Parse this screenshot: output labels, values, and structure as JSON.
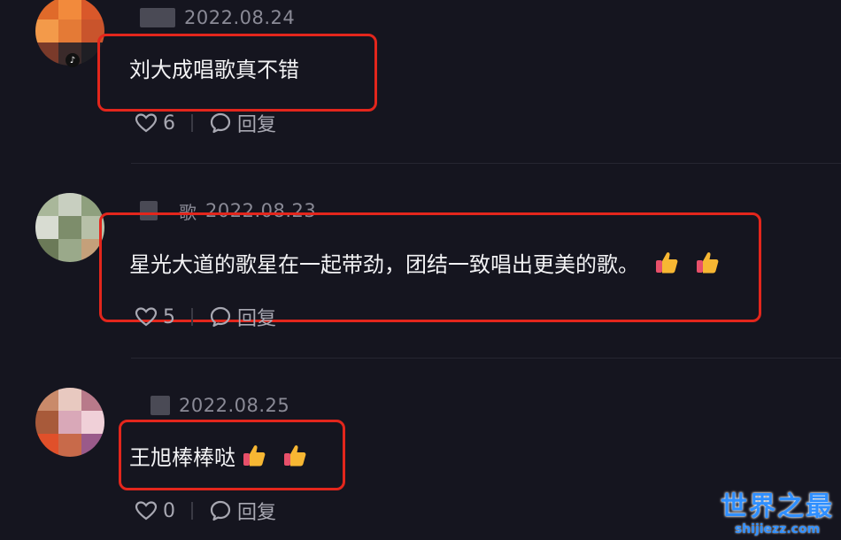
{
  "comments": [
    {
      "name": "",
      "date": "2022.08.24",
      "text": "刘大成唱歌真不错",
      "likes": "6",
      "reply_label": "回复",
      "emojis": []
    },
    {
      "name": "歌",
      "date": "2022.08.23",
      "text": "星光大道的歌星在一起带劲，团结一致唱出更美的歌。",
      "likes": "5",
      "reply_label": "回复",
      "emojis": [
        "thumbs-up",
        "thumbs-up"
      ]
    },
    {
      "name": "",
      "date": "2022.08.25",
      "text": "王旭棒棒哒",
      "likes": "0",
      "reply_label": "回复",
      "emojis": [
        "thumbs-up",
        "thumbs-up"
      ]
    }
  ],
  "watermark": {
    "title": "世界之最",
    "url": "shijiezz.com"
  },
  "colors": {
    "highlight": "#e3261c",
    "background": "#15151f",
    "watermark": "#2f8fff"
  },
  "icons": {
    "like": "heart-outline-icon",
    "reply": "speech-bubble-icon",
    "emoji": "thumbs-up-icon",
    "avatar_badge": "tiktok-note-icon"
  }
}
